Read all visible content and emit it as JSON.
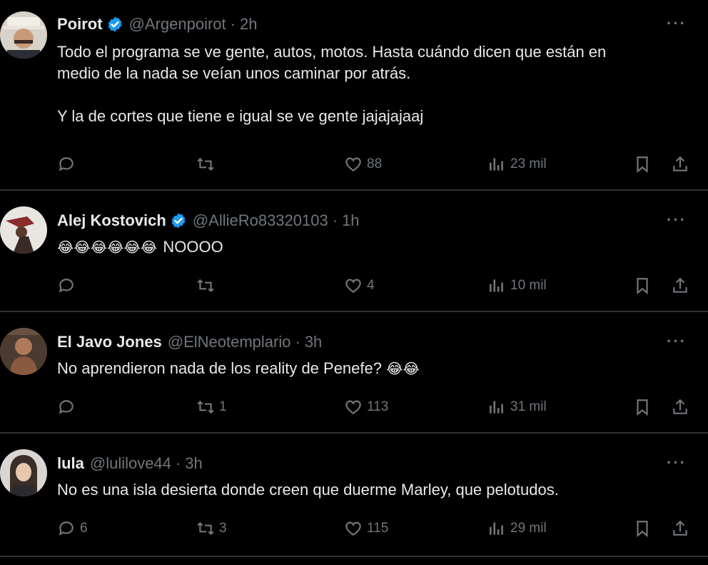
{
  "tweets": [
    {
      "name": "Poirot",
      "verified": true,
      "handle": "@Argenpoirot",
      "sep": "·",
      "time": "2h",
      "lines": [
        "Todo el programa se ve gente, autos, motos. Hasta cuándo dicen que están en",
        "medio de la nada se veían unos caminar por atrás.",
        "Y la de cortes que tiene e igual se ve gente jajajajaaj"
      ],
      "replies": "",
      "retweets": "",
      "likes": "88",
      "views": "23 mil"
    },
    {
      "name": "Alej Kostovich",
      "verified": true,
      "handle": "@AllieRo83320103",
      "sep": "·",
      "time": "1h",
      "emoji": "😂😂😂😂😂😂",
      "lines": [
        "NOOOO"
      ],
      "replies": "",
      "retweets": "",
      "likes": "4",
      "views": "10 mil"
    },
    {
      "name": "El Javo Jones",
      "verified": false,
      "handle": "@ElNeotemplario",
      "sep": "·",
      "time": "3h",
      "lines": [
        "No aprendieron nada de los reality de Penefe?"
      ],
      "emoji_after": "😂😂",
      "replies": "",
      "retweets": "1",
      "likes": "113",
      "views": "31 mil"
    },
    {
      "name": "lula",
      "verified": false,
      "handle": "@lulilove44",
      "sep": "·",
      "time": "3h",
      "lines": [
        "No es una isla desierta donde creen que duerme Marley, que pelotudos."
      ],
      "replies": "6",
      "retweets": "3",
      "likes": "115",
      "views": "29 mil"
    }
  ],
  "icons": {
    "more": "more-icon",
    "reply": "reply-icon",
    "retweet": "retweet-icon",
    "like": "heart-icon",
    "views": "views-icon",
    "bookmark": "bookmark-icon",
    "share": "share-icon",
    "verified": "verified-badge-icon"
  },
  "colors": {
    "background": "#000000",
    "text": "#e7e9ea",
    "muted": "#71767b",
    "verified": "#1d9bf0",
    "divider": "#2f3336"
  },
  "more_label": "···"
}
